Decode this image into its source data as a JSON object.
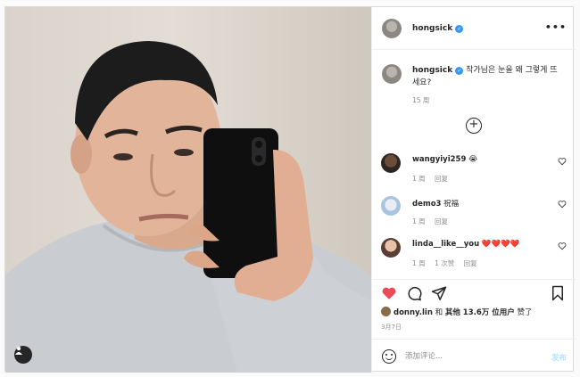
{
  "post": {
    "author": "hongsick",
    "more_icon": "more-horizontal-icon",
    "caption": "작가님은 눈을 왜 그렇게 뜨세요?",
    "caption_time": "15 周",
    "load_more_icon": "plus-circle-icon"
  },
  "comments": [
    {
      "user": "wangyiyi259",
      "text": "😭",
      "time": "1 周",
      "reply": "回复",
      "likes": ""
    },
    {
      "user": "demo3",
      "text": "祝福",
      "time": "1 周",
      "reply": "回复",
      "likes": ""
    },
    {
      "user": "linda__like__you",
      "text": "❤️❤️❤️❤️",
      "time": "1 周",
      "reply": "回复",
      "likes": "1 次赞"
    }
  ],
  "actions": {
    "like_icon": "heart-filled-icon",
    "comment_icon": "comment-icon",
    "share_icon": "send-icon",
    "save_icon": "bookmark-icon",
    "like_color": "#ed4956"
  },
  "likes": {
    "user": "donny.lin",
    "conj": "和",
    "others": "其他 13.6万 位用户",
    "suffix": "赞了"
  },
  "date": "3月7日",
  "add_comment": {
    "placeholder": "添加评论...",
    "post_label": "发布"
  }
}
